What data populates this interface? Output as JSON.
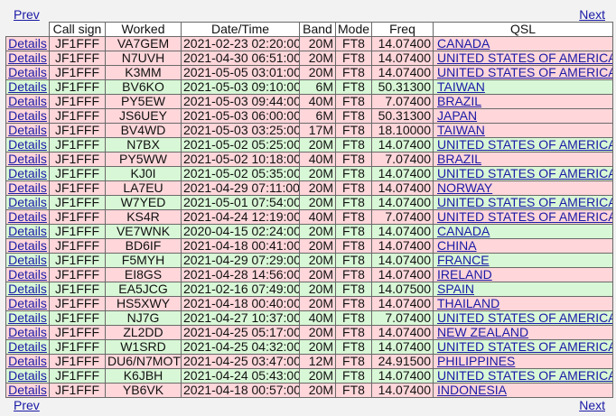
{
  "nav": {
    "prev_label": "Prev",
    "next_label": "Next"
  },
  "table": {
    "headers": [
      "",
      "Call sign",
      "Worked",
      "Date/Time",
      "Band",
      "Mode",
      "Freq",
      "QSL"
    ],
    "details_label": "Details",
    "rows": [
      {
        "call": "JF1FFF",
        "worked": "VA7GEM",
        "datetime": "2021-02-23 02:20:00",
        "band": "20M",
        "mode": "FT8",
        "freq": "14.07400",
        "qsl": "CANADA",
        "color": "pink"
      },
      {
        "call": "JF1FFF",
        "worked": "N7UVH",
        "datetime": "2021-04-30 06:51:00",
        "band": "20M",
        "mode": "FT8",
        "freq": "14.07400",
        "qsl": "UNITED STATES OF AMERICA",
        "color": "pink"
      },
      {
        "call": "JF1FFF",
        "worked": "K3MM",
        "datetime": "2021-05-05 03:01:00",
        "band": "20M",
        "mode": "FT8",
        "freq": "14.07400",
        "qsl": "UNITED STATES OF AMERICA",
        "color": "pink"
      },
      {
        "call": "JF1FFF",
        "worked": "BV6KO",
        "datetime": "2021-05-03 09:10:00",
        "band": "6M",
        "mode": "FT8",
        "freq": "50.31300",
        "qsl": "TAIWAN",
        "color": "green"
      },
      {
        "call": "JF1FFF",
        "worked": "PY5EW",
        "datetime": "2021-05-03 09:44:00",
        "band": "40M",
        "mode": "FT8",
        "freq": "7.07400",
        "qsl": "BRAZIL",
        "color": "pink"
      },
      {
        "call": "JF1FFF",
        "worked": "JS6UEY",
        "datetime": "2021-05-03 06:00:00",
        "band": "6M",
        "mode": "FT8",
        "freq": "50.31300",
        "qsl": "JAPAN",
        "color": "pink"
      },
      {
        "call": "JF1FFF",
        "worked": "BV4WD",
        "datetime": "2021-05-03 03:25:00",
        "band": "17M",
        "mode": "FT8",
        "freq": "18.10000",
        "qsl": "TAIWAN",
        "color": "pink"
      },
      {
        "call": "JF1FFF",
        "worked": "N7BX",
        "datetime": "2021-05-02 05:25:00",
        "band": "20M",
        "mode": "FT8",
        "freq": "14.07400",
        "qsl": "UNITED STATES OF AMERICA",
        "color": "green"
      },
      {
        "call": "JF1FFF",
        "worked": "PY5WW",
        "datetime": "2021-05-02 10:18:00",
        "band": "40M",
        "mode": "FT8",
        "freq": "7.07400",
        "qsl": "BRAZIL",
        "color": "pink"
      },
      {
        "call": "JF1FFF",
        "worked": "KJ0I",
        "datetime": "2021-05-02 05:35:00",
        "band": "20M",
        "mode": "FT8",
        "freq": "14.07400",
        "qsl": "UNITED STATES OF AMERICA",
        "color": "green"
      },
      {
        "call": "JF1FFF",
        "worked": "LA7EU",
        "datetime": "2021-04-29 07:11:00",
        "band": "20M",
        "mode": "FT8",
        "freq": "14.07400",
        "qsl": "NORWAY",
        "color": "pink"
      },
      {
        "call": "JF1FFF",
        "worked": "W7YED",
        "datetime": "2021-05-01 07:54:00",
        "band": "20M",
        "mode": "FT8",
        "freq": "14.07400",
        "qsl": "UNITED STATES OF AMERICA",
        "color": "green"
      },
      {
        "call": "JF1FFF",
        "worked": "KS4R",
        "datetime": "2021-04-24 12:19:00",
        "band": "40M",
        "mode": "FT8",
        "freq": "7.07400",
        "qsl": "UNITED STATES OF AMERICA",
        "color": "pink"
      },
      {
        "call": "JF1FFF",
        "worked": "VE7WNK",
        "datetime": "2020-04-15 02:24:00",
        "band": "20M",
        "mode": "FT8",
        "freq": "14.07400",
        "qsl": "CANADA",
        "color": "green"
      },
      {
        "call": "JF1FFF",
        "worked": "BD6IF",
        "datetime": "2021-04-18 00:41:00",
        "band": "20M",
        "mode": "FT8",
        "freq": "14.07400",
        "qsl": "CHINA",
        "color": "pink"
      },
      {
        "call": "JF1FFF",
        "worked": "F5MYH",
        "datetime": "2021-04-29 07:29:00",
        "band": "20M",
        "mode": "FT8",
        "freq": "14.07400",
        "qsl": "FRANCE",
        "color": "green"
      },
      {
        "call": "JF1FFF",
        "worked": "EI8GS",
        "datetime": "2021-04-28 14:56:00",
        "band": "20M",
        "mode": "FT8",
        "freq": "14.07400",
        "qsl": "IRELAND",
        "color": "pink"
      },
      {
        "call": "JF1FFF",
        "worked": "EA5JCG",
        "datetime": "2021-02-16 07:49:00",
        "band": "20M",
        "mode": "FT8",
        "freq": "14.07500",
        "qsl": "SPAIN",
        "color": "green"
      },
      {
        "call": "JF1FFF",
        "worked": "HS5XWY",
        "datetime": "2021-04-18 00:40:00",
        "band": "20M",
        "mode": "FT8",
        "freq": "14.07400",
        "qsl": "THAILAND",
        "color": "pink"
      },
      {
        "call": "JF1FFF",
        "worked": "NJ7G",
        "datetime": "2021-04-27 10:37:00",
        "band": "40M",
        "mode": "FT8",
        "freq": "7.07400",
        "qsl": "UNITED STATES OF AMERICA",
        "color": "green"
      },
      {
        "call": "JF1FFF",
        "worked": "ZL2DD",
        "datetime": "2021-04-25 05:17:00",
        "band": "20M",
        "mode": "FT8",
        "freq": "14.07400",
        "qsl": "NEW ZEALAND",
        "color": "pink"
      },
      {
        "call": "JF1FFF",
        "worked": "W1SRD",
        "datetime": "2021-04-25 04:32:00",
        "band": "20M",
        "mode": "FT8",
        "freq": "14.07400",
        "qsl": "UNITED STATES OF AMERICA",
        "color": "green"
      },
      {
        "call": "JF1FFF",
        "worked": "DU6/N7MOT",
        "datetime": "2021-04-25 03:47:00",
        "band": "12M",
        "mode": "FT8",
        "freq": "24.91500",
        "qsl": "PHILIPPINES",
        "color": "pink"
      },
      {
        "call": "JF1FFF",
        "worked": "K6JBH",
        "datetime": "2021-04-24 05:43:00",
        "band": "20M",
        "mode": "FT8",
        "freq": "14.07400",
        "qsl": "UNITED STATES OF AMERICA",
        "color": "green"
      },
      {
        "call": "JF1FFF",
        "worked": "YB6VK",
        "datetime": "2021-04-18 00:57:00",
        "band": "20M",
        "mode": "FT8",
        "freq": "14.07400",
        "qsl": "INDONESIA",
        "color": "pink"
      }
    ]
  },
  "colors": {
    "pink_row": "#ffd6da",
    "green_row": "#d8f7d6",
    "link": "#1a1aa6"
  }
}
